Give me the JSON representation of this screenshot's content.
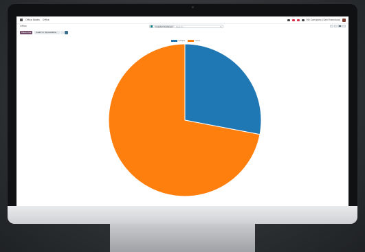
{
  "app": {
    "menu_title": "Office Notes",
    "section": "Office"
  },
  "breadcrumb": "Office",
  "search": {
    "facet_label": "Created between",
    "placeholder": "Search..."
  },
  "navbar": {
    "company": "My Company (San Francisco)"
  },
  "toolbar": {
    "measures_label": "Measures",
    "insert_label": "Insert in Spreadsheet"
  },
  "colors": {
    "series_blue": "#1f77b4",
    "series_orange": "#ff7f0e",
    "brand": "#714b67"
  },
  "chart_data": {
    "type": "pie",
    "labels": [
      "Hotels",
      "Lead"
    ],
    "values": [
      28,
      72
    ],
    "colors": [
      "#1f77b4",
      "#ff7f0e"
    ]
  }
}
